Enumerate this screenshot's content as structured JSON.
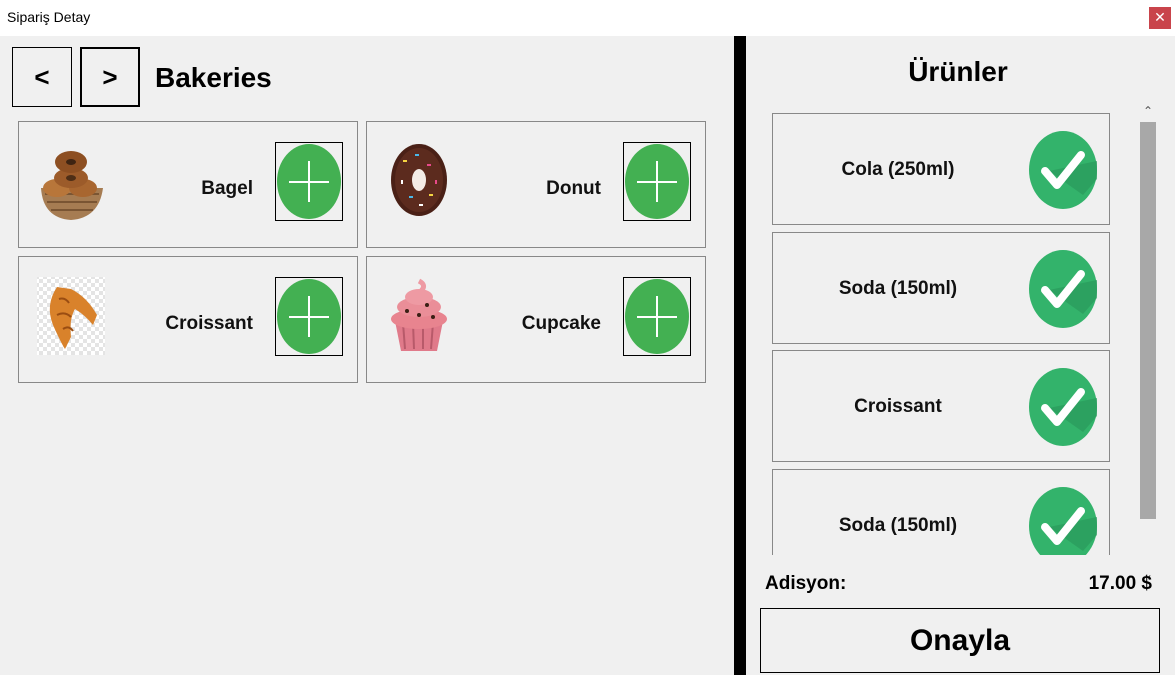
{
  "window": {
    "title": "Sipariş Detay",
    "close_symbol": "✕"
  },
  "category": {
    "prev_label": "<",
    "next_label": ">",
    "title": "Bakeries"
  },
  "products": [
    {
      "name": "Bagel",
      "icon": "bagel-image"
    },
    {
      "name": "Donut",
      "icon": "donut-image"
    },
    {
      "name": "Croissant",
      "icon": "croissant-image"
    },
    {
      "name": "Cupcake",
      "icon": "cupcake-image"
    }
  ],
  "order": {
    "title": "Ürünler",
    "items": [
      {
        "name": "Cola (250ml)"
      },
      {
        "name": "Soda (150ml)"
      },
      {
        "name": "Croissant"
      },
      {
        "name": "Soda (150ml)"
      }
    ],
    "bill_label": "Adisyon:",
    "bill_total": "17.00 $",
    "confirm_label": "Onayla"
  },
  "colors": {
    "add_green": "#43b052",
    "check_green": "#33b36b",
    "divider": "#000000"
  }
}
